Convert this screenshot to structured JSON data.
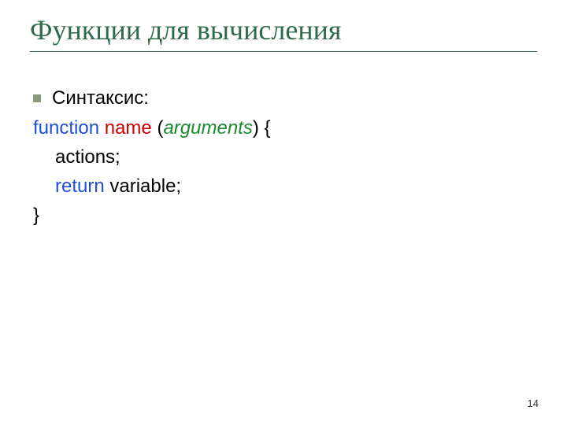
{
  "title": "Функции для вычисления",
  "bullet": {
    "label": "Синтаксис:"
  },
  "code": {
    "function_kw": "function",
    "name_kw": "name",
    "args_kw": "arguments",
    "open": "(",
    "close": ")",
    "brace_open": "{",
    "actions": "actions;",
    "return_kw": "return",
    "variable": "variable;",
    "brace_close": "}"
  },
  "page_number": "14"
}
